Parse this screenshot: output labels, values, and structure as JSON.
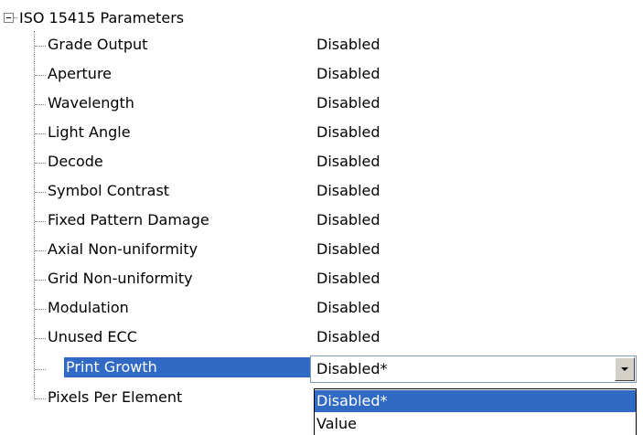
{
  "tree": {
    "root_label": "ISO 15415 Parameters",
    "expander_state": "expanded",
    "items": [
      {
        "label": "Grade Output",
        "value": "Disabled"
      },
      {
        "label": "Aperture",
        "value": "Disabled"
      },
      {
        "label": "Wavelength",
        "value": "Disabled"
      },
      {
        "label": "Light Angle",
        "value": "Disabled"
      },
      {
        "label": "Decode",
        "value": "Disabled"
      },
      {
        "label": "Symbol Contrast",
        "value": "Disabled"
      },
      {
        "label": "Fixed Pattern Damage",
        "value": "Disabled"
      },
      {
        "label": "Axial Non-uniformity",
        "value": "Disabled"
      },
      {
        "label": "Grid Non-uniformity",
        "value": "Disabled"
      },
      {
        "label": "Modulation",
        "value": "Disabled"
      },
      {
        "label": "Unused ECC",
        "value": "Disabled"
      },
      {
        "label": "Print Growth",
        "value": "Disabled*"
      },
      {
        "label": "Pixels Per Element",
        "value": ""
      }
    ]
  },
  "selected_item": "Print Growth",
  "dropdown": {
    "current_value": "Disabled*",
    "options": [
      "Disabled*",
      "Value"
    ],
    "highlighted_option": "Disabled*"
  },
  "colors": {
    "selection": "#316ac5",
    "selection_text": "#ffffff",
    "tree_lines": "#808080"
  }
}
